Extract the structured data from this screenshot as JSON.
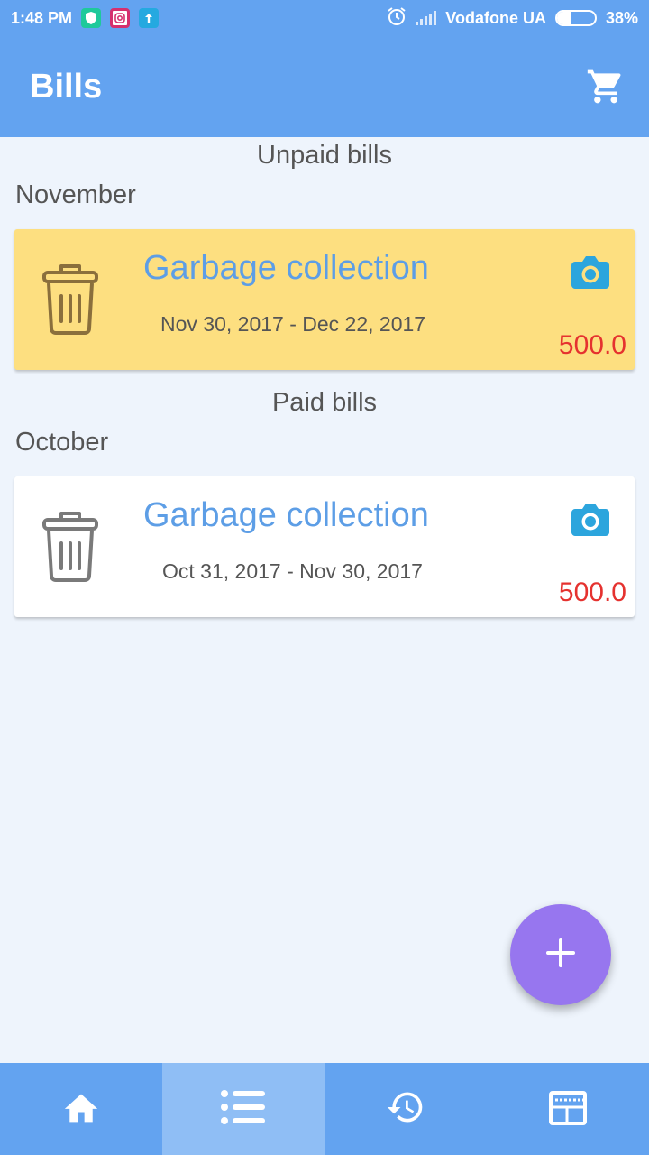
{
  "status_bar": {
    "time": "1:48 PM",
    "carrier": "Vodafone UA",
    "battery_text": "38%",
    "battery_level": 0.38,
    "icons": [
      "shield-icon",
      "instagram-icon",
      "upload-icon",
      "alarm-icon",
      "signal-icon",
      "battery-icon"
    ]
  },
  "app_bar": {
    "title": "Bills",
    "action_icon": "cart-icon"
  },
  "sections": {
    "unpaid": {
      "title": "Unpaid bills",
      "month": "November",
      "bill": {
        "name": "Garbage collection",
        "period": "Nov 30, 2017 - Dec 22, 2017",
        "amount": "500.0"
      }
    },
    "paid": {
      "title": "Paid bills",
      "month": "October",
      "bill": {
        "name": "Garbage collection",
        "period": "Oct 31, 2017 - Nov 30, 2017",
        "amount": "500.0"
      }
    }
  },
  "fab": {
    "icon": "plus-icon"
  },
  "bottom_nav": {
    "items": [
      {
        "icon": "home-icon",
        "active": false
      },
      {
        "icon": "list-icon",
        "active": true
      },
      {
        "icon": "history-icon",
        "active": false
      },
      {
        "icon": "calendar-icon",
        "active": false
      }
    ]
  },
  "colors": {
    "primary": "#63a3f0",
    "unpaid_card": "#fddf80",
    "amount": "#e5322f",
    "bill_title": "#5d9ee6",
    "fab": "#9776ef",
    "camera": "#2ca5dd"
  }
}
